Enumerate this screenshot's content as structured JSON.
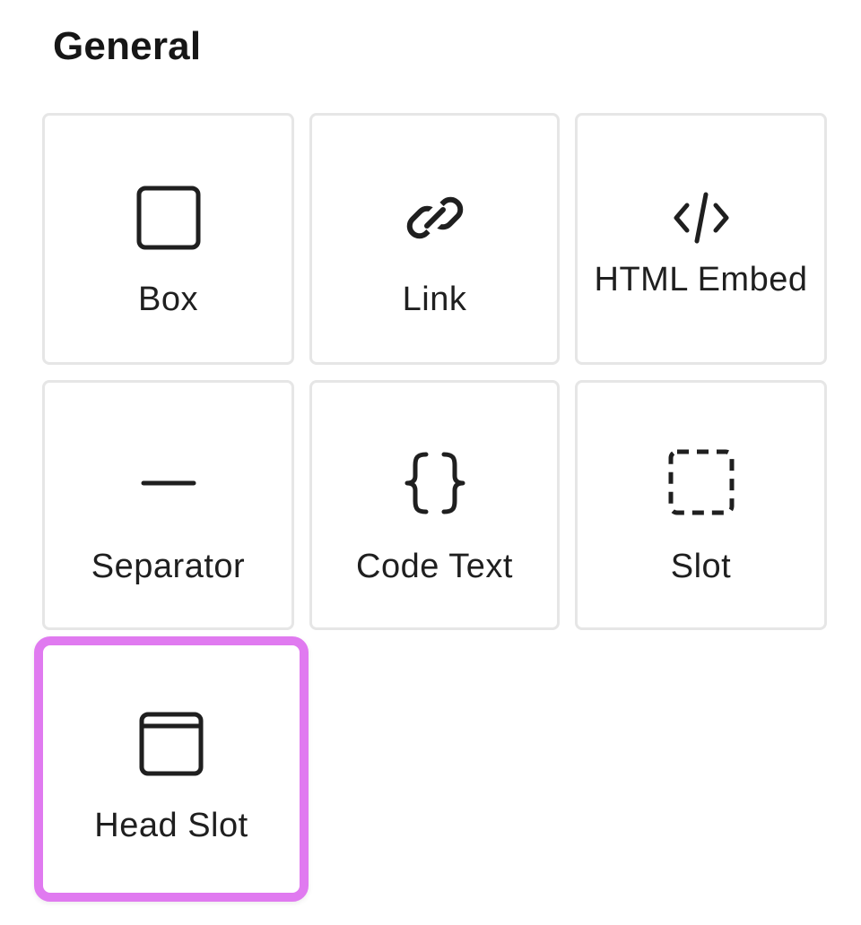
{
  "section": {
    "title": "General"
  },
  "accent_color": "#e07af0",
  "tiles": [
    {
      "label": "Box",
      "icon": "box-icon"
    },
    {
      "label": "Link",
      "icon": "link-icon"
    },
    {
      "label": "HTML Embed",
      "icon": "code-embed-icon"
    },
    {
      "label": "Separator",
      "icon": "separator-icon"
    },
    {
      "label": "Code Text",
      "icon": "curly-braces-icon"
    },
    {
      "label": "Slot",
      "icon": "dashed-box-icon"
    },
    {
      "label": "Head Slot",
      "icon": "head-slot-icon",
      "highlighted": true
    }
  ]
}
